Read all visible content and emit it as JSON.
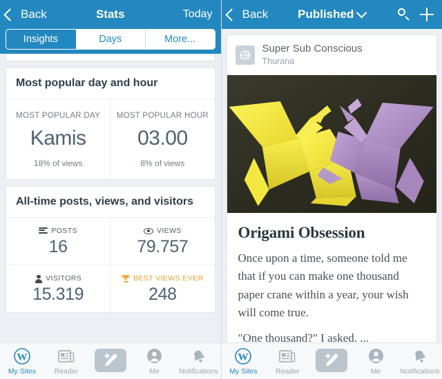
{
  "theme": {
    "nav_blue": "#2388c0",
    "bg": "#eceff4",
    "card": "#ffffff",
    "text_dark": "#2e3d49",
    "text_muted": "#6f7c87",
    "gold": "#e3a32e"
  },
  "left_pane": {
    "nav": {
      "back_label": "Back",
      "title": "Stats",
      "today_label": "Today"
    },
    "segments": [
      {
        "label": "Insights",
        "active": true
      },
      {
        "label": "Days",
        "active": false
      },
      {
        "label": "More...",
        "active": false
      }
    ],
    "cards": [
      {
        "title": "Most popular day and hour",
        "stats": [
          {
            "label": "MOST POPULAR DAY",
            "value": "Kamis",
            "sub": "18% of views"
          },
          {
            "label": "MOST POPULAR HOUR",
            "value": "03.00",
            "sub": "8% of views"
          }
        ]
      },
      {
        "title": "All-time posts, views, and visitors",
        "quads": [
          {
            "icon": "posts-icon",
            "label": "POSTS",
            "value": "16",
            "gold": false
          },
          {
            "icon": "eye-icon",
            "label": "VIEWS",
            "value": "79.757",
            "gold": false
          },
          {
            "icon": "visitor-icon",
            "label": "VISITORS",
            "value": "15.319",
            "gold": false
          },
          {
            "icon": "trophy-icon",
            "label": "BEST VIEWS EVER",
            "value": "248",
            "gold": true
          }
        ]
      }
    ]
  },
  "right_pane": {
    "nav": {
      "back_label": "Back",
      "title": "Published",
      "search_icon": "search-icon",
      "add_icon": "plus-icon"
    },
    "post": {
      "site_icon": "globe-icon",
      "site_name": "Super Sub Conscious",
      "author": "Thurana",
      "image_alt": "two origami paper cranes, yellow and purple, on a dark background",
      "title": "Origami Obsession",
      "paragraph_1": "Once upon a time, someone told me that if you can make one thousand paper crane within a year, your wish will come true.",
      "paragraph_2": "\"One thousand?\" I asked. ..."
    }
  },
  "tabbar": {
    "items": [
      {
        "label": "My Sites",
        "icon": "wordpress-icon",
        "active": true
      },
      {
        "label": "Reader",
        "icon": "newspaper-icon",
        "active": false
      },
      {
        "label": "",
        "icon": "compose-icon",
        "active": false
      },
      {
        "label": "Me",
        "icon": "person-icon",
        "active": false
      },
      {
        "label": "Notifications",
        "icon": "bell-icon",
        "active": false
      }
    ]
  }
}
